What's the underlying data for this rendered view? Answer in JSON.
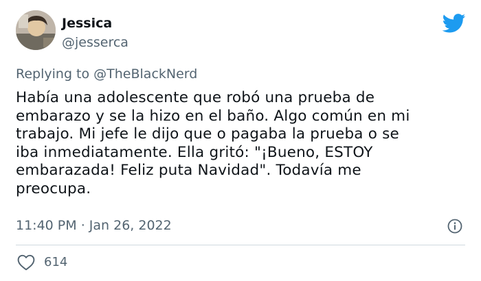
{
  "author": {
    "display_name": "Jessica",
    "handle": "@jesserca"
  },
  "reply": {
    "prefix": "Replying to ",
    "mention": "@TheBlackNerd"
  },
  "tweet": {
    "text": "Había una adolescente que robó una prueba de\nembarazo y se la hizo en el baño. Algo común en mi\ntrabajo. Mi jefe le dijo que o pagaba la prueba o se\niba inmediatamente. Ella gritó: \"¡Bueno, ESTOY\nembarazada! Feliz puta Navidad\". Todavía me\npreocupa.",
    "time": "11:40 PM",
    "separator": " · ",
    "date": "Jan 26, 2022"
  },
  "engagement": {
    "likes": "614"
  },
  "icons": {
    "brand": "twitter-bird-icon",
    "info": "info-icon",
    "like": "heart-icon"
  },
  "colors": {
    "brand": "#1d9bf0",
    "text_primary": "#0f1419",
    "text_secondary": "#536471",
    "divider": "#cfd9de"
  }
}
